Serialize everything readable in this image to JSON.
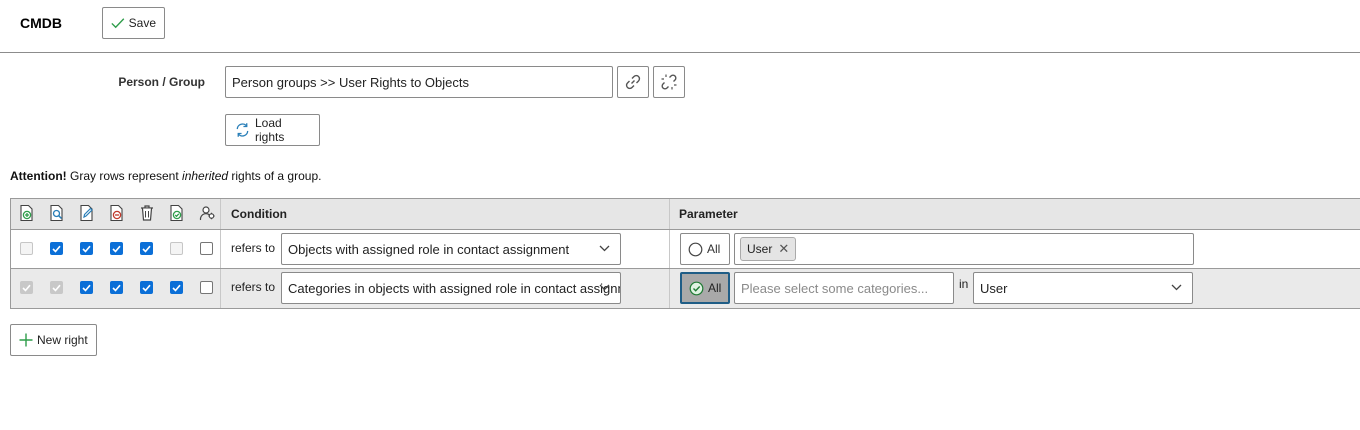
{
  "header": {
    "title": "CMDB",
    "save_label": "Save",
    "save_icon": "check-icon"
  },
  "form": {
    "person_label": "Person / Group",
    "person_value": "Person groups >> User Rights to Objects",
    "attach_icon": "link-icon",
    "detach_icon": "unlink-icon",
    "load_label": "Load rights",
    "load_icon": "refresh-icon"
  },
  "attention": {
    "strong": "Attention!",
    "pre": " Gray rows represent ",
    "em": "inherited",
    "post": " rights of a group."
  },
  "table": {
    "right_icons": [
      "create-icon",
      "view-icon",
      "edit-icon",
      "archive-icon",
      "delete-icon",
      "execute-icon",
      "supervisor-icon"
    ],
    "condition_header": "Condition",
    "parameter_header": "Parameter",
    "rows": [
      {
        "inherited": false,
        "rights": [
          false,
          true,
          true,
          true,
          true,
          false,
          false
        ],
        "rights_disabled": [
          true,
          false,
          false,
          false,
          false,
          true,
          false
        ],
        "refers_label": "refers to",
        "condition": "Objects with assigned role in contact assignment",
        "all_label": "All",
        "all_active": false,
        "tags": [
          "User"
        ]
      },
      {
        "inherited": true,
        "rights": [
          true,
          true,
          true,
          true,
          true,
          true,
          false
        ],
        "rights_disabled": [
          true,
          true,
          false,
          false,
          false,
          false,
          false
        ],
        "refers_label": "refers to",
        "condition": "Categories in objects with assigned role in contact assignment",
        "all_label": "All",
        "all_active": true,
        "category_placeholder": "Please select some categories...",
        "in_label": "in",
        "role_value": "User"
      }
    ]
  },
  "new_right_label": "New right",
  "colors": {
    "accent": "#0b6fd7",
    "icon_green": "#2e9d4a",
    "active_border": "#1f5d86",
    "inherited_row": "#eaeaea"
  }
}
